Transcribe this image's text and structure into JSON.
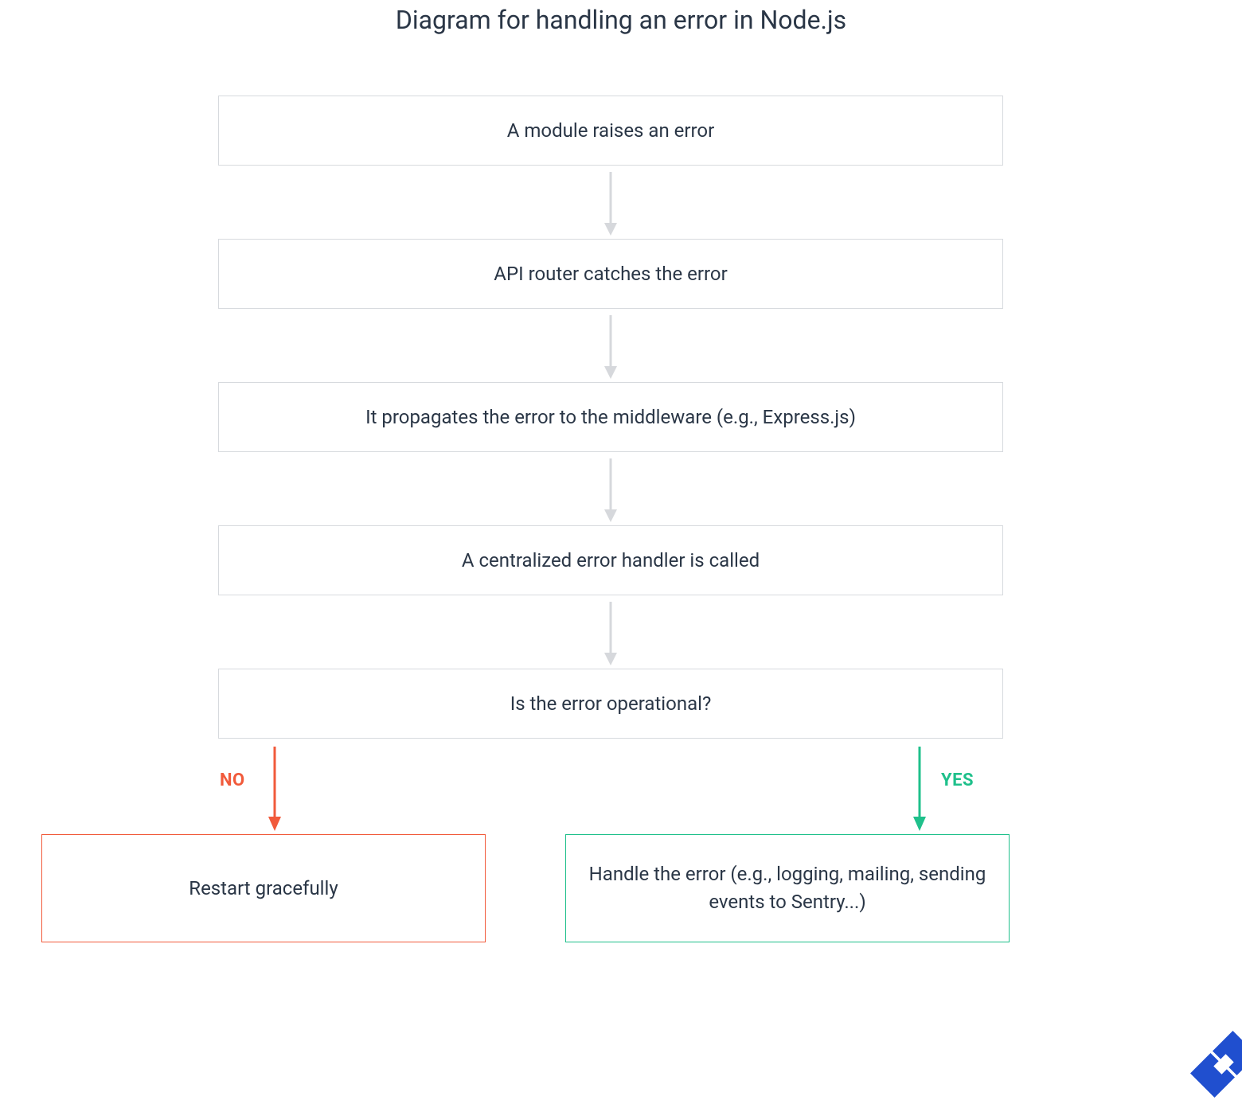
{
  "title": "Diagram for handling an error in Node.js",
  "nodes": {
    "step1": "A module raises an error",
    "step2": "API router catches the error",
    "step3": "It propagates the error to the middleware (e.g., Express.js)",
    "step4": "A centralized error handler is called",
    "step5": "Is the error operational?",
    "no": "Restart gracefully",
    "yes": "Handle the error (e.g., logging, mailing, sending events to Sentry...)"
  },
  "branches": {
    "no_label": "NO",
    "yes_label": "YES"
  },
  "colors": {
    "node_border": "#d7dade",
    "no": "#f15a3b",
    "yes": "#1fc08b",
    "text": "#2a3646",
    "arrow": "#d6d8dc",
    "logo": "#204fcf"
  }
}
